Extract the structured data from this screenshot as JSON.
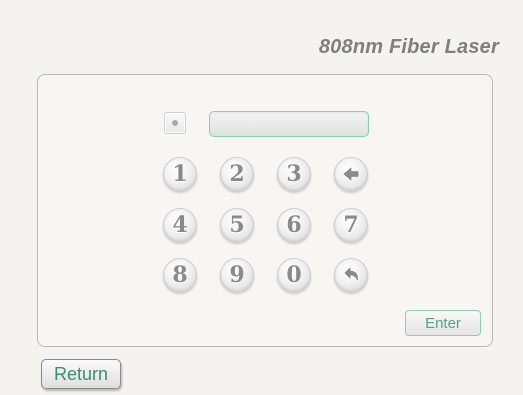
{
  "header": {
    "title": "808nm Fiber Laser"
  },
  "pin_entry": {
    "indicator_icon": "status-dot",
    "value": ""
  },
  "keypad": {
    "keys": [
      {
        "label": "1",
        "icon": null
      },
      {
        "label": "2",
        "icon": null
      },
      {
        "label": "3",
        "icon": null
      },
      {
        "label": "",
        "icon": "backspace-arrow"
      },
      {
        "label": "4",
        "icon": null
      },
      {
        "label": "5",
        "icon": null
      },
      {
        "label": "6",
        "icon": null
      },
      {
        "label": "7",
        "icon": null
      },
      {
        "label": "8",
        "icon": null
      },
      {
        "label": "9",
        "icon": null
      },
      {
        "label": "0",
        "icon": null
      },
      {
        "label": "",
        "icon": "undo-arrow"
      }
    ]
  },
  "actions": {
    "enter_label": "Enter",
    "return_label": "Return"
  },
  "colors": {
    "accent": "#55a286",
    "border_accent": "#8ecfb3",
    "title": "#7f7f7f",
    "background": "#f4f3ef"
  }
}
